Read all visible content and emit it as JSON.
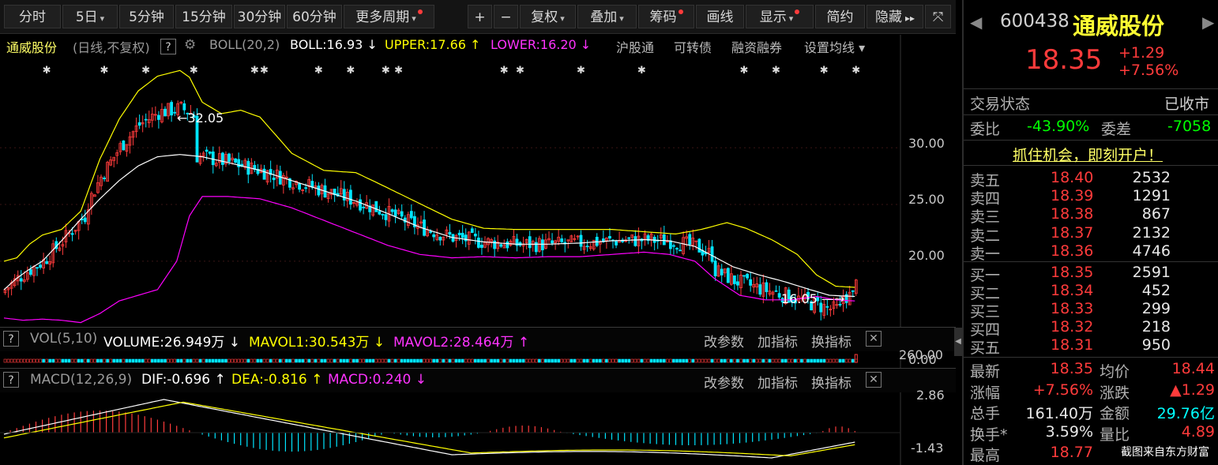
{
  "toolbar": {
    "items": [
      {
        "label": "分时",
        "dot": false,
        "caret": false
      },
      {
        "label": "5日",
        "dot": false,
        "caret": true
      },
      {
        "label": "5分钟",
        "dot": false,
        "caret": false
      },
      {
        "label": "15分钟",
        "dot": false,
        "caret": false
      },
      {
        "label": "30分钟",
        "dot": false,
        "caret": false
      },
      {
        "label": "60分钟",
        "dot": false,
        "caret": false
      },
      {
        "label": "更多周期",
        "dot": true,
        "caret": true
      },
      {
        "label": "+",
        "dot": false,
        "caret": false
      },
      {
        "label": "−",
        "dot": false,
        "caret": false
      },
      {
        "label": "复权",
        "dot": false,
        "caret": true
      },
      {
        "label": "叠加",
        "dot": false,
        "caret": true
      },
      {
        "label": "筹码",
        "dot": true,
        "caret": false
      },
      {
        "label": "画线",
        "dot": false,
        "caret": false
      },
      {
        "label": "显示",
        "dot": true,
        "caret": true
      },
      {
        "label": "简约",
        "dot": false,
        "caret": false
      },
      {
        "label": "隐藏",
        "dot": false,
        "caret": false,
        "suffix": "▸▸"
      },
      {
        "label": "⤧",
        "dot": false,
        "caret": false
      }
    ]
  },
  "main_info": {
    "stock": "通威股份",
    "mode": "(日线,不复权)",
    "help": "?",
    "indicator": "BOLL(20,2)",
    "boll": "BOLL:16.93 ↓",
    "upper": "UPPER:17.66 ↑",
    "lower": "LOWER:16.20 ↓",
    "links": [
      "沪股通",
      "可转债",
      "融资融券",
      "设置均线 ▾"
    ]
  },
  "colors": {
    "up": "#ff3b3b",
    "down": "#00e5ff",
    "yellow": "#ffff00",
    "magenta": "#ff00ff",
    "white": "#ffffff",
    "green": "#00ff00"
  },
  "chart_data": {
    "type": "candlestick",
    "y_ticks": [
      "30.00",
      "25.00",
      "20.00"
    ],
    "ylim": [
      14.5,
      38
    ],
    "annotations": {
      "high": "32.05",
      "low": "16.05"
    },
    "boll_mid": [
      [
        0,
        17.5
      ],
      [
        4,
        18.5
      ],
      [
        8,
        19.3
      ],
      [
        12,
        20.0
      ],
      [
        18,
        21.8
      ],
      [
        24,
        23.7
      ],
      [
        30,
        25.5
      ],
      [
        36,
        27.1
      ],
      [
        42,
        28.4
      ],
      [
        48,
        29.2
      ],
      [
        55,
        29.4
      ],
      [
        62,
        29.2
      ],
      [
        70,
        28.7
      ],
      [
        80,
        28.0
      ],
      [
        90,
        27.1
      ],
      [
        100,
        26.2
      ],
      [
        110,
        25.3
      ],
      [
        120,
        24.2
      ],
      [
        130,
        23.0
      ],
      [
        140,
        22.1
      ],
      [
        150,
        21.7
      ],
      [
        160,
        21.5
      ],
      [
        170,
        21.5
      ],
      [
        180,
        21.6
      ],
      [
        190,
        21.8
      ],
      [
        200,
        21.9
      ],
      [
        208,
        21.8
      ],
      [
        216,
        21.3
      ],
      [
        222,
        20.4
      ],
      [
        228,
        19.5
      ],
      [
        236,
        18.8
      ],
      [
        244,
        18.2
      ],
      [
        252,
        17.5
      ],
      [
        258,
        17.0
      ],
      [
        266,
        16.9
      ]
    ],
    "boll_upper": [
      [
        0,
        20.0
      ],
      [
        4,
        20.3
      ],
      [
        8,
        21.5
      ],
      [
        12,
        22.3
      ],
      [
        18,
        22.8
      ],
      [
        24,
        24.4
      ],
      [
        30,
        29.0
      ],
      [
        36,
        32.5
      ],
      [
        42,
        35.0
      ],
      [
        48,
        36.3
      ],
      [
        55,
        36.8
      ],
      [
        58,
        36.2
      ],
      [
        62,
        34.0
      ],
      [
        68,
        33.0
      ],
      [
        74,
        33.3
      ],
      [
        80,
        32.7
      ],
      [
        90,
        29.5
      ],
      [
        100,
        28.0
      ],
      [
        110,
        27.8
      ],
      [
        116,
        27.0
      ],
      [
        124,
        25.9
      ],
      [
        132,
        24.8
      ],
      [
        140,
        23.7
      ],
      [
        150,
        22.9
      ],
      [
        160,
        22.8
      ],
      [
        170,
        22.8
      ],
      [
        180,
        22.8
      ],
      [
        190,
        22.8
      ],
      [
        200,
        22.6
      ],
      [
        210,
        22.4
      ],
      [
        218,
        22.8
      ],
      [
        226,
        23.4
      ],
      [
        232,
        22.9
      ],
      [
        240,
        21.9
      ],
      [
        248,
        20.6
      ],
      [
        254,
        18.8
      ],
      [
        260,
        17.8
      ],
      [
        266,
        17.7
      ]
    ],
    "boll_lower": [
      [
        0,
        15.0
      ],
      [
        6,
        14.8
      ],
      [
        12,
        14.9
      ],
      [
        18,
        14.8
      ],
      [
        24,
        14.6
      ],
      [
        30,
        15.4
      ],
      [
        36,
        16.5
      ],
      [
        42,
        17.0
      ],
      [
        48,
        17.5
      ],
      [
        54,
        20.0
      ],
      [
        58,
        24.0
      ],
      [
        62,
        25.7
      ],
      [
        70,
        25.7
      ],
      [
        80,
        25.5
      ],
      [
        90,
        24.7
      ],
      [
        100,
        23.6
      ],
      [
        110,
        22.5
      ],
      [
        120,
        21.4
      ],
      [
        130,
        20.6
      ],
      [
        140,
        20.3
      ],
      [
        150,
        20.4
      ],
      [
        160,
        20.3
      ],
      [
        170,
        20.4
      ],
      [
        180,
        20.4
      ],
      [
        190,
        20.6
      ],
      [
        200,
        20.8
      ],
      [
        208,
        20.6
      ],
      [
        216,
        20.0
      ],
      [
        222,
        18.5
      ],
      [
        230,
        17.0
      ],
      [
        238,
        16.6
      ],
      [
        246,
        16.6
      ],
      [
        254,
        16.9
      ],
      [
        260,
        16.6
      ],
      [
        266,
        16.5
      ]
    ]
  },
  "vol_panel": {
    "help": "?",
    "label": "VOL(5,10)",
    "volume": "VOLUME:26.949万 ↓",
    "mavol1": "MAVOL1:30.543万 ↓",
    "mavol2": "MAVOL2:28.464万 ↑",
    "btns": [
      "改参数",
      "加指标",
      "换指标"
    ],
    "axis_top": "260.00",
    "axis_bottom": "0.00"
  },
  "macd_panel": {
    "help": "?",
    "label": "MACD(12,26,9)",
    "dif": "DIF:-0.696 ↑",
    "dea": "DEA:-0.816 ↑",
    "macd": "MACD:0.240 ↓",
    "btns": [
      "改参数",
      "加指标",
      "换指标"
    ],
    "axis_top": "2.86",
    "axis_bottom": "-1.43"
  },
  "quote": {
    "code": "600438",
    "name": "通威股份",
    "price": "18.35",
    "change": "+1.29",
    "pct": "+7.56%",
    "status_label": "交易状态",
    "status_value": "已收市",
    "weibi_label": "委比",
    "weibi_value": "-43.90%",
    "weicha_label": "委差",
    "weicha_value": "-7058",
    "promo": "抓住机会，即刻开户！",
    "asks": [
      {
        "label": "卖五",
        "price": "18.40",
        "vol": "2532"
      },
      {
        "label": "卖四",
        "price": "18.39",
        "vol": "1291"
      },
      {
        "label": "卖三",
        "price": "18.38",
        "vol": "867"
      },
      {
        "label": "卖二",
        "price": "18.37",
        "vol": "2132"
      },
      {
        "label": "卖一",
        "price": "18.36",
        "vol": "4746"
      }
    ],
    "bids": [
      {
        "label": "买一",
        "price": "18.35",
        "vol": "2591"
      },
      {
        "label": "买二",
        "price": "18.34",
        "vol": "452"
      },
      {
        "label": "买三",
        "price": "18.33",
        "vol": "299"
      },
      {
        "label": "买四",
        "price": "18.32",
        "vol": "218"
      },
      {
        "label": "买五",
        "price": "18.31",
        "vol": "950"
      }
    ],
    "stats": [
      {
        "l1": "最新",
        "v1": "18.35",
        "l2": "均价",
        "v2": "18.44"
      },
      {
        "l1": "涨幅",
        "v1": "+7.56%",
        "l2": "涨跌",
        "v2": "▲1.29"
      },
      {
        "l1": "总手",
        "v1": "161.40万",
        "l2": "金额",
        "v2": "29.76亿"
      },
      {
        "l1": "换手*",
        "v1": "3.59%",
        "l2": "量比",
        "v2": "4.89"
      },
      {
        "l1": "最高",
        "v1": "18.77",
        "l2": "",
        "v2": ""
      }
    ]
  },
  "watermark": "截图来自东方财富"
}
